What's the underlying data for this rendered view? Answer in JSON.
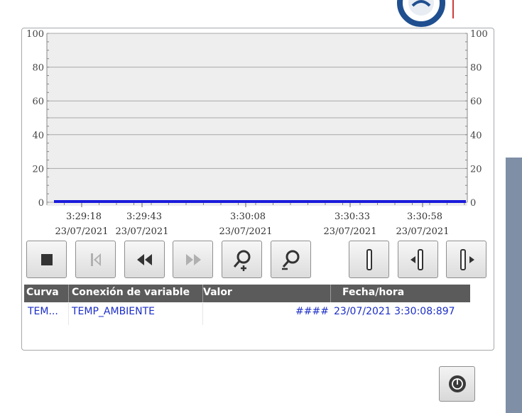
{
  "trend": {
    "y_axis_left_ticks": [
      "100",
      "80",
      "60",
      "40",
      "20",
      "0"
    ],
    "y_axis_right_ticks": [
      "100",
      "80",
      "60",
      "40",
      "20",
      "0"
    ],
    "x_axis": [
      {
        "time": "3:29:18",
        "date": "23/07/2021"
      },
      {
        "time": "3:29:43",
        "date": "23/07/2021"
      },
      {
        "time": "3:30:08",
        "date": "23/07/2021"
      },
      {
        "time": "3:30:33",
        "date": "23/07/2021"
      },
      {
        "time": "3:30:58",
        "date": "23/07/2021"
      }
    ],
    "line_color": "#1a1adc",
    "ylim": [
      0,
      100
    ]
  },
  "chart_data": {
    "type": "line",
    "x": [
      "3:29:18 23/07/2021",
      "3:29:43 23/07/2021",
      "3:30:08 23/07/2021",
      "3:30:33 23/07/2021",
      "3:30:58 23/07/2021"
    ],
    "series": [
      {
        "values": [
          0,
          0,
          0,
          0,
          0
        ]
      }
    ],
    "ylim": [
      0,
      100
    ],
    "grid": true
  },
  "controls": {
    "icons": [
      "stop-icon",
      "first-icon",
      "rewind-icon",
      "forward-icon",
      "zoom-in-icon",
      "zoom-out-icon",
      "ruler-icon",
      "ruler-left-icon",
      "ruler-right-icon"
    ]
  },
  "table": {
    "headers": {
      "curve": "Curva",
      "connection": "Conexión de variable",
      "value": "Valor",
      "datetime": "Fecha/hora"
    },
    "rows": [
      {
        "curve": "TEM...",
        "connection": "TEMP_AMBIENTE",
        "value": "####",
        "datetime": "23/07/2021 3:30:08:897"
      }
    ]
  },
  "power_button": {
    "icon": "power-icon"
  },
  "colors": {
    "header_bg": "#5b5b5b",
    "row_text": "#1c2ec8",
    "chart_bg": "#eeeeee",
    "side_strip": "#7e8fa6"
  }
}
